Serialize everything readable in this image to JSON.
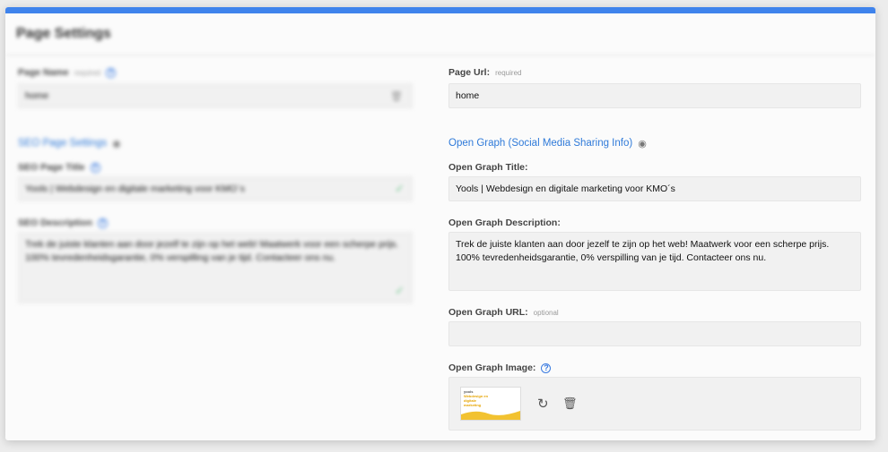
{
  "header": {
    "title": "Page Settings"
  },
  "page_name": {
    "label": "Page Name",
    "hint": "required",
    "value": "home"
  },
  "page_url": {
    "label": "Page Url:",
    "hint": "required",
    "value": "home"
  },
  "seo": {
    "section_label": "SEO Page Settings",
    "title_label": "SEO Page Title",
    "title_value": "Yools | Webdesign en digitale marketing voor KMO´s",
    "description_label": "SEO Description",
    "description_value": "Trek de juiste klanten aan door jezelf te zijn op het web! Maatwerk voor een scherpe prijs. 100% tevredenheidsgarantie, 0% verspilling van je tijd. Contacteer ons nu."
  },
  "open_graph": {
    "section_label": "Open Graph (Social Media Sharing Info)",
    "title_label": "Open Graph Title:",
    "title_value": "Yools | Webdesign en digitale marketing voor KMO´s",
    "description_label": "Open Graph Description:",
    "description_value": "Trek de juiste klanten aan door jezelf te zijn op het web! Maatwerk voor een scherpe prijs. 100% tevredenheidsgarantie, 0% verspilling van je tijd. Contacteer ons nu.",
    "url_label": "Open Graph URL:",
    "url_hint": "optional",
    "url_value": "",
    "image_label": "Open Graph Image:"
  },
  "colors": {
    "accent": "#3f83ec",
    "link": "#2f7ad9",
    "success": "#6cc58a"
  },
  "icons": {
    "help": "question-circle-icon",
    "eye": "eye-icon",
    "check": "check-icon",
    "trash": "trash-icon",
    "refresh": "refresh-icon"
  }
}
